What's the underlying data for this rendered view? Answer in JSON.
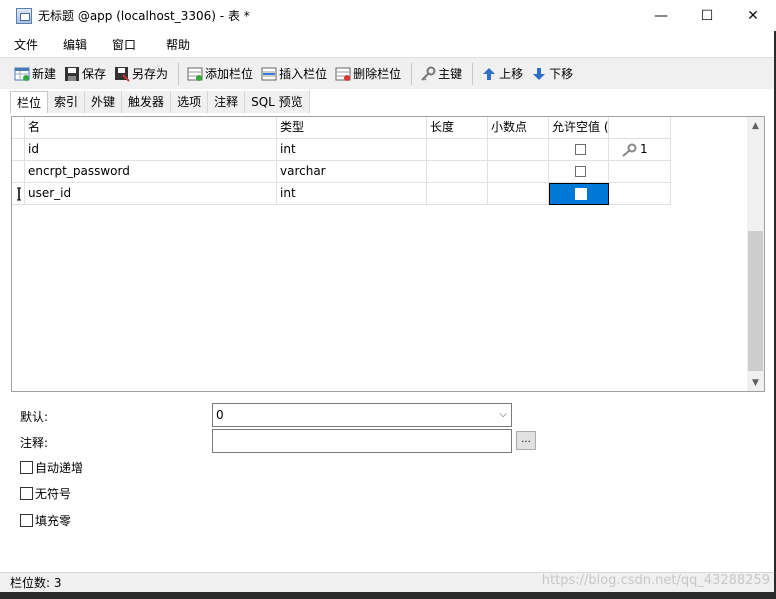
{
  "window": {
    "title": "无标题 @app (localhost_3306) - 表 *",
    "controls": {
      "minimize": "—",
      "maximize": "☐",
      "close": "✕"
    }
  },
  "menu": [
    "文件",
    "编辑",
    "窗口",
    "帮助"
  ],
  "toolbar": {
    "new": "新建",
    "save": "保存",
    "save_as": "另存为",
    "add_field": "添加栏位",
    "insert_field": "插入栏位",
    "delete_field": "删除栏位",
    "primary_key": "主键",
    "move_up": "上移",
    "move_down": "下移"
  },
  "tabs": [
    "栏位",
    "索引",
    "外键",
    "触发器",
    "选项",
    "注释",
    "SQL 预览"
  ],
  "grid": {
    "headers": [
      "名",
      "类型",
      "长度",
      "小数点",
      "允许空值 (",
      ""
    ],
    "rows": [
      {
        "name": "id",
        "type": "int",
        "length": "",
        "decimals": "",
        "key": "1"
      },
      {
        "name": "encrpt_password",
        "type": "varchar",
        "length": "",
        "decimals": "",
        "key": ""
      },
      {
        "name": "user_id",
        "type": "int",
        "length": "",
        "decimals": "",
        "key": ""
      }
    ]
  },
  "properties": {
    "default_label": "默认:",
    "default_value": "0",
    "comment_label": "注释:",
    "comment_value": "",
    "ellipsis": "...",
    "auto_increment": "自动递增",
    "unsigned": "无符号",
    "zerofill": "填充零"
  },
  "status": {
    "field_count": "栏位数: 3",
    "watermark": "https://blog.csdn.net/qq_43288259"
  },
  "colors": {
    "selection": "#0078d7",
    "toolbar_bg": "#f0f0f0"
  }
}
